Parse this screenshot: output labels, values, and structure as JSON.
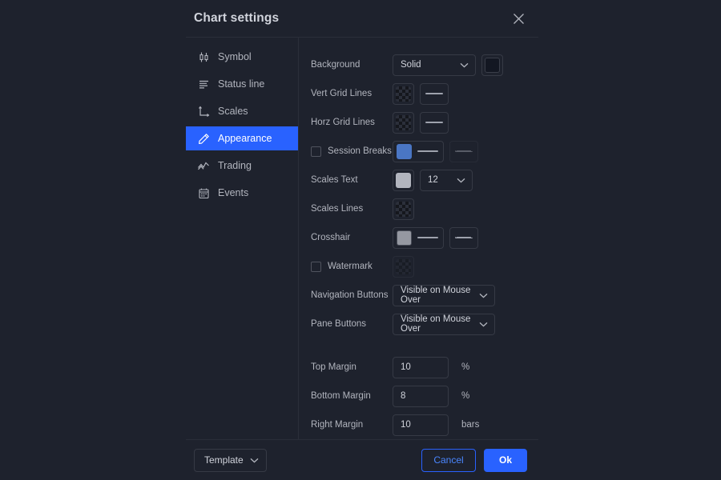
{
  "dialog": {
    "title": "Chart settings",
    "close_icon": "close-icon"
  },
  "sidebar": {
    "items": [
      {
        "label": "Symbol",
        "icon": "candlestick-icon"
      },
      {
        "label": "Status line",
        "icon": "status-lines-icon"
      },
      {
        "label": "Scales",
        "icon": "axes-icon"
      },
      {
        "label": "Appearance",
        "icon": "pencil-icon",
        "active": true
      },
      {
        "label": "Trading",
        "icon": "zigzag-icon"
      },
      {
        "label": "Events",
        "icon": "calendar-icon"
      }
    ]
  },
  "form": {
    "background": {
      "label": "Background",
      "select_value": "Solid",
      "swatch_color": "#131722"
    },
    "vert_grid_lines": {
      "label": "Vert Grid Lines",
      "swatch": "transparent-checker",
      "line_style": "solid"
    },
    "horz_grid_lines": {
      "label": "Horz Grid Lines",
      "swatch": "transparent-checker",
      "line_style": "solid"
    },
    "session_breaks": {
      "label": "Session Breaks",
      "checked": false,
      "swatch_color": "#4a76c4",
      "line_style": "solid",
      "dash_style": "dashed",
      "dash_disabled": true
    },
    "scales_text": {
      "label": "Scales Text",
      "swatch_color": "#b2b5be",
      "font_size": "12"
    },
    "scales_lines": {
      "label": "Scales Lines",
      "swatch": "transparent-checker"
    },
    "crosshair": {
      "label": "Crosshair",
      "swatch_color": "#9598a1",
      "line_style": "solid",
      "dash_style": "dashed"
    },
    "watermark": {
      "label": "Watermark",
      "checked": false,
      "swatch": "transparent-checker"
    },
    "navigation_buttons": {
      "label": "Navigation Buttons",
      "value": "Visible on Mouse Over"
    },
    "pane_buttons": {
      "label": "Pane Buttons",
      "value": "Visible on Mouse Over"
    },
    "top_margin": {
      "label": "Top Margin",
      "value": "10",
      "unit": "%"
    },
    "bottom_margin": {
      "label": "Bottom Margin",
      "value": "8",
      "unit": "%"
    },
    "right_margin": {
      "label": "Right Margin",
      "value": "10",
      "unit": "bars"
    }
  },
  "footer": {
    "template_label": "Template",
    "cancel_label": "Cancel",
    "ok_label": "Ok"
  },
  "colors": {
    "accent": "#2962ff",
    "dialog_bg": "#1e222d",
    "border": "#2a2e39",
    "text": "#b2b5be"
  }
}
